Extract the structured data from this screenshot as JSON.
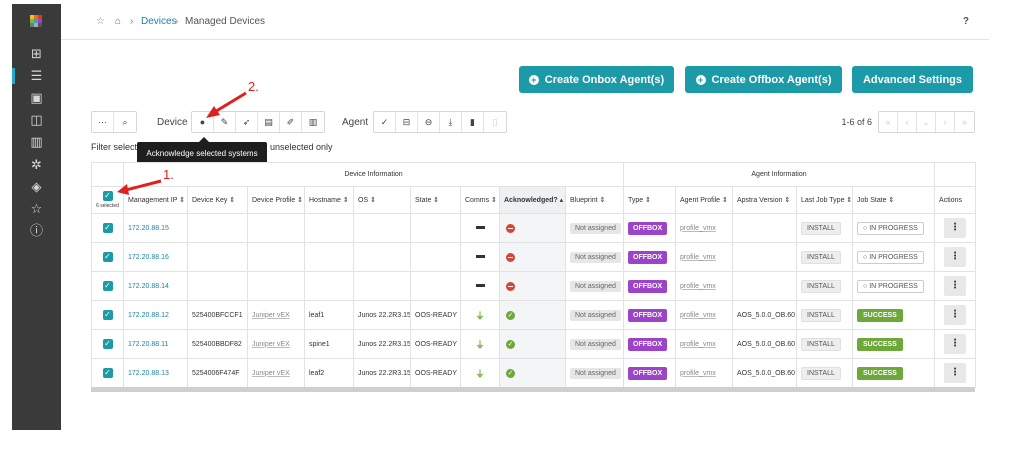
{
  "breadcrumb": {
    "devices": "Devices",
    "current": "Managed Devices",
    "help": "?"
  },
  "actions": {
    "create_onbox": "Create Onbox Agent(s)",
    "create_offbox": "Create Offbox Agent(s)",
    "advanced": "Advanced Settings"
  },
  "toolbar": {
    "device_label": "Device",
    "agent_label": "Agent",
    "pagination": "1-6 of 6",
    "more": "···"
  },
  "filter": {
    "prefix": "Filter selecte",
    "suffix": "unselected only"
  },
  "tooltip": "Acknowledge selected systems",
  "annotations": {
    "one": "1.",
    "two": "2."
  },
  "table": {
    "group_device": "Device Information",
    "group_agent": "Agent Information",
    "selected_count": "6 selected",
    "columns": [
      "Management IP",
      "Device Key",
      "Device Profile",
      "Hostname",
      "OS",
      "State",
      "Comms",
      "Acknowledged?",
      "Blueprint",
      "Type",
      "Agent Profile",
      "Apstra Version",
      "Last Job Type",
      "Job State",
      "Actions"
    ],
    "rows": [
      {
        "ip": "172.20.88.15",
        "key": "",
        "profile": "",
        "hostname": "",
        "os": "",
        "state": "",
        "comms": "none",
        "ack": "no",
        "blueprint": "Not assigned",
        "type": "OFFBOX",
        "agent_profile": "profile_vmx",
        "version": "",
        "last_job": "INSTALL",
        "job_state": "IN PROGRESS"
      },
      {
        "ip": "172.20.88.16",
        "key": "",
        "profile": "",
        "hostname": "",
        "os": "",
        "state": "",
        "comms": "none",
        "ack": "no",
        "blueprint": "Not assigned",
        "type": "OFFBOX",
        "agent_profile": "profile_vmx",
        "version": "",
        "last_job": "INSTALL",
        "job_state": "IN PROGRESS"
      },
      {
        "ip": "172.20.88.14",
        "key": "",
        "profile": "",
        "hostname": "",
        "os": "",
        "state": "",
        "comms": "none",
        "ack": "no",
        "blueprint": "Not assigned",
        "type": "OFFBOX",
        "agent_profile": "profile_vmx",
        "version": "",
        "last_job": "INSTALL",
        "job_state": "IN PROGRESS"
      },
      {
        "ip": "172.20.88.12",
        "key": "525400BFCCF1",
        "profile": "Juniper vEX",
        "hostname": "leaf1",
        "os": "Junos 22.2R3.15",
        "state": "OOS-READY",
        "comms": "ok",
        "ack": "yes",
        "blueprint": "Not assigned",
        "type": "OFFBOX",
        "agent_profile": "profile_vmx",
        "version": "AOS_5.0.0_OB.60",
        "last_job": "INSTALL",
        "job_state": "SUCCESS"
      },
      {
        "ip": "172.20.88.11",
        "key": "525400BBDF82",
        "profile": "Juniper vEX",
        "hostname": "spine1",
        "os": "Junos 22.2R3.15",
        "state": "OOS-READY",
        "comms": "ok",
        "ack": "yes",
        "blueprint": "Not assigned",
        "type": "OFFBOX",
        "agent_profile": "profile_vmx",
        "version": "AOS_5.0.0_OB.60",
        "last_job": "INSTALL",
        "job_state": "SUCCESS"
      },
      {
        "ip": "172.20.88.13",
        "key": "5254006F474F",
        "profile": "Juniper vEX",
        "hostname": "leaf2",
        "os": "Junos 22.2R3.15",
        "state": "OOS-READY",
        "comms": "ok",
        "ack": "yes",
        "blueprint": "Not assigned",
        "type": "OFFBOX",
        "agent_profile": "profile_vmx",
        "version": "AOS_5.0.0_OB.60",
        "last_job": "INSTALL",
        "job_state": "SUCCESS"
      }
    ]
  },
  "colors": {
    "teal": "#1c9aa8",
    "offbox": "#9b44c8",
    "success": "#6ea83a",
    "danger": "#d6453a",
    "nav": "#3a3a3a",
    "annotation": "#e02020"
  }
}
